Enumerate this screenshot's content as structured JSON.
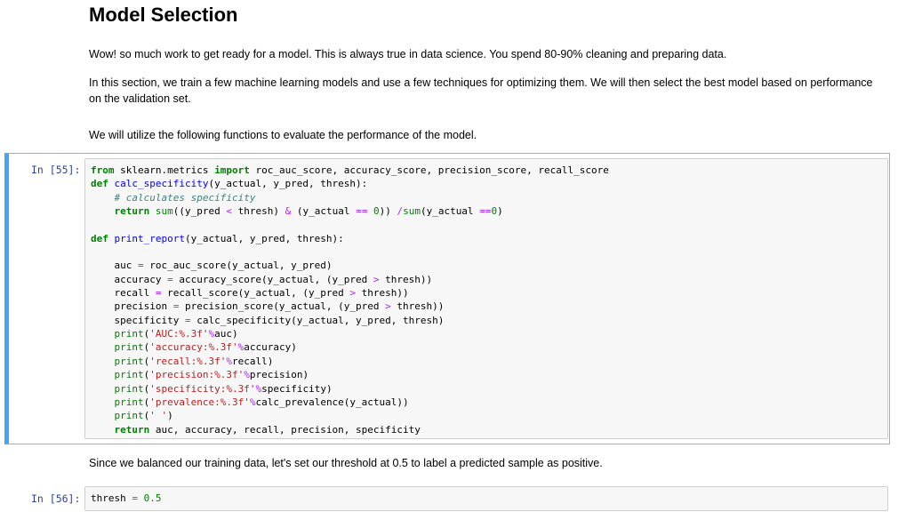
{
  "heading": "Model Selection",
  "paragraphs": {
    "p1": "Wow! so much work to get ready for a model. This is always true in data science. You spend 80-90% cleaning and preparing data.",
    "p2": "In this section, we train a few machine learning models and use a few techniques for optimizing them. We will then select the best model based on performance on the validation set.",
    "p3": "We will utilize the following functions to evaluate the performance of the model.",
    "p4": "Since we balanced our training data, let's set our threshold at 0.5 to label a predicted sample as positive."
  },
  "cells": {
    "cell55": {
      "prompt": "In [55]:"
    },
    "cell56": {
      "prompt": "In [56]:"
    }
  },
  "colors": {
    "accent": "#42a5f5",
    "prompt": "#303f9f",
    "keyword": "#008000",
    "string": "#ba2121",
    "operator": "#aa22ff"
  }
}
